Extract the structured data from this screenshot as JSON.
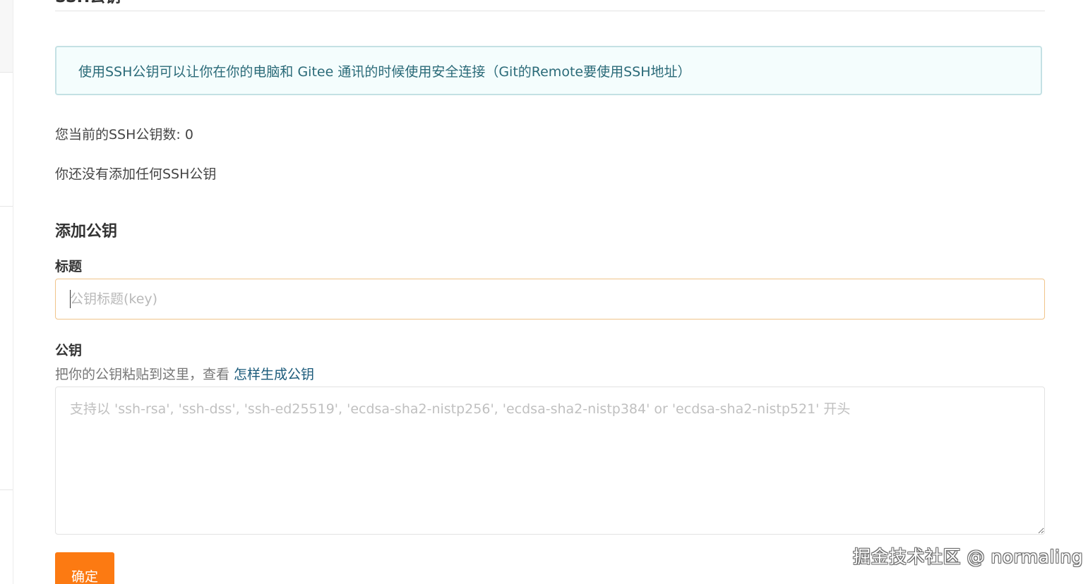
{
  "header": {
    "section_title": "SSH公钥"
  },
  "info": {
    "message": "使用SSH公钥可以让你在你的电脑和 Gitee 通讯的时候使用安全连接（Git的Remote要使用SSH地址）"
  },
  "status": {
    "count_text": "您当前的SSH公钥数: 0",
    "empty_text": "你还没有添加任何SSH公钥"
  },
  "form": {
    "heading": "添加公钥",
    "title_label": "标题",
    "title_placeholder": "公钥标题(key)",
    "title_value": "",
    "key_label": "公钥",
    "key_hint_prefix": "把你的公钥粘贴到这里，查看 ",
    "key_hint_link": "怎样生成公钥",
    "key_placeholder": "支持以 'ssh-rsa', 'ssh-dss', 'ssh-ed25519', 'ecdsa-sha2-nistp256', 'ecdsa-sha2-nistp384' or 'ecdsa-sha2-nistp521' 开头",
    "key_value": "",
    "submit_label": "确定"
  },
  "watermark": {
    "text": "掘金技术社区 @ normaling"
  },
  "colors": {
    "accent": "#fc7a12",
    "info_background": "#f4fdfd",
    "info_border": "#c4e1e4",
    "info_text": "#2a6a78",
    "link": "#1a5a7a",
    "input_focus_border": "#f0c48a"
  }
}
